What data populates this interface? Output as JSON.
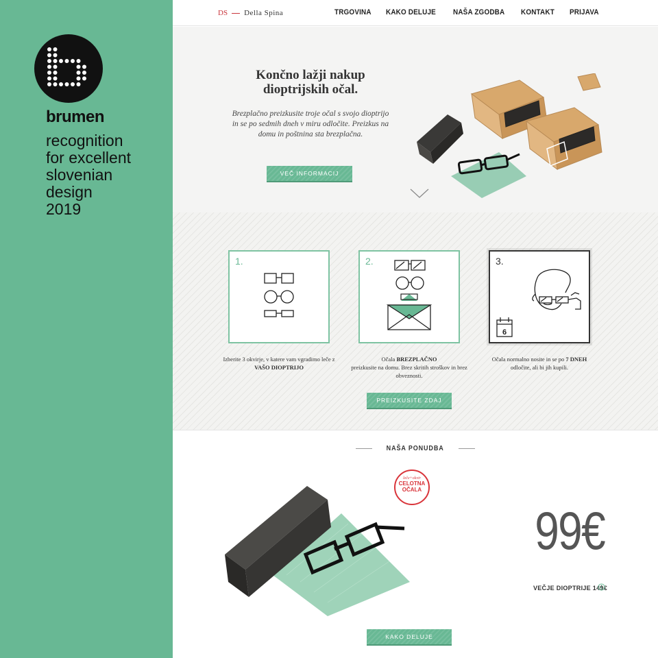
{
  "award": {
    "brand": "brumen",
    "lines": [
      "recognition",
      "for excellent",
      "slovenian",
      "design",
      "2019"
    ]
  },
  "site": {
    "logo": {
      "monogram": "DS",
      "name": "Della Spina"
    },
    "nav": [
      "TRGOVINA",
      "KAKO DELUJE",
      "NAŠA ZGODBA",
      "KONTAKT",
      "PRIJAVA"
    ],
    "hero": {
      "title": "Končno lažji nakup dioptrijskih očal.",
      "text": "Brezplačno preizkusite troje očal s svojo dioptrijo in se po sedmih dneh v miru odločite. Preizkus na domu in poštnina sta brezplačna.",
      "button": "VEČ INFORMACIJ"
    },
    "steps": [
      {
        "num": "1.",
        "caption_pre": "Izberite 3 okvirje, v katere vam vgradimo leče z",
        "caption_bold": "VAŠO DIOPTRIJO",
        "caption_post": ""
      },
      {
        "num": "2.",
        "caption_pre": "Očala",
        "caption_bold": "BREZPLAČNO",
        "caption_post": "preizkusite na domu. Brez skritih stroškov in brez obveznosti."
      },
      {
        "num": "3.",
        "calendar_day": "6",
        "caption_pre": "Očala normalno nosite in se po",
        "caption_bold": "7 DNEH",
        "caption_post": "odločite, ali bi jih kupili."
      }
    ],
    "steps_button": "PREIZKUSITE ZDAJ",
    "offer": {
      "heading": "NAŠA PONUDBA",
      "badge_small": "leče+okvir",
      "badge_line1": "CELOTNA",
      "badge_line2": "OČALA",
      "price": "99€",
      "price_note": "VEČJE DIOPTRIJE 149€",
      "button": "KAKO DELUJE"
    }
  },
  "colors": {
    "green": "#68b894",
    "red": "#c9353c",
    "dark": "#333333"
  }
}
